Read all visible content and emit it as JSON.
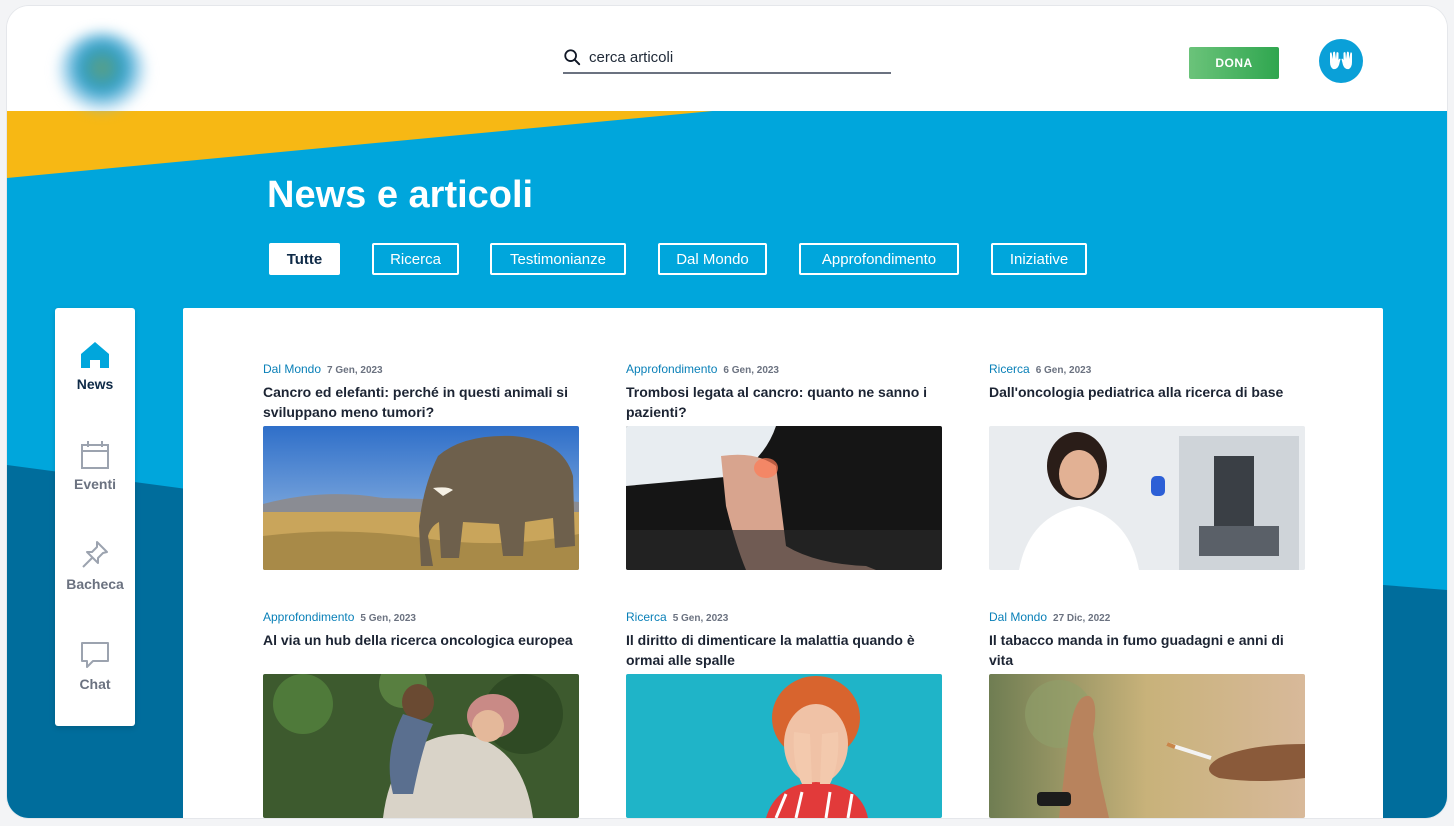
{
  "search": {
    "placeholder": "cerca articoli"
  },
  "header": {
    "donate_label": "DONA"
  },
  "page": {
    "title": "News e articoli"
  },
  "filters": [
    {
      "label": "Tutte",
      "active": true
    },
    {
      "label": "Ricerca",
      "active": false
    },
    {
      "label": "Testimonianze",
      "active": false
    },
    {
      "label": "Dal Mondo",
      "active": false
    },
    {
      "label": "Approfondimento",
      "active": false
    },
    {
      "label": "Iniziative",
      "active": false
    }
  ],
  "sidebar": {
    "items": [
      {
        "label": "News",
        "icon": "home-icon",
        "active": true
      },
      {
        "label": "Eventi",
        "icon": "calendar-icon",
        "active": false
      },
      {
        "label": "Bacheca",
        "icon": "pin-icon",
        "active": false
      },
      {
        "label": "Chat",
        "icon": "chat-icon",
        "active": false
      }
    ]
  },
  "articles": [
    {
      "category": "Dal Mondo",
      "date": "7 Gen, 2023",
      "title": "Cancro ed elefanti: perché in questi animali si sviluppano meno tumori?",
      "image": "elephant-photo"
    },
    {
      "category": "Approfondimento",
      "date": "6 Gen, 2023",
      "title": "Trombosi legata al cancro: quanto ne sanno i pazienti?",
      "image": "leg-pain-photo"
    },
    {
      "category": "Ricerca",
      "date": "6 Gen, 2023",
      "title": "Dall'oncologia pediatrica alla ricerca di base",
      "image": "researcher-microscope-photo"
    },
    {
      "category": "Approfondimento",
      "date": "5 Gen, 2023",
      "title": "Al via un hub della ricerca oncologica europea",
      "image": "mother-child-photo"
    },
    {
      "category": "Ricerca",
      "date": "5 Gen, 2023",
      "title": "Il diritto di dimenticare la malattia quando è ormai alle spalle",
      "image": "woman-covering-face-photo"
    },
    {
      "category": "Dal Mondo",
      "date": "27 Dic, 2022",
      "title": "Il tabacco manda in fumo guadagni e anni di vita",
      "image": "refusing-cigarette-photo"
    }
  ],
  "colors": {
    "brand_blue": "#00a6dc",
    "dark_blue": "#006d9c",
    "yellow": "#f7b814",
    "donate_green": "#4cb865",
    "heading_navy": "#0e2a47"
  }
}
